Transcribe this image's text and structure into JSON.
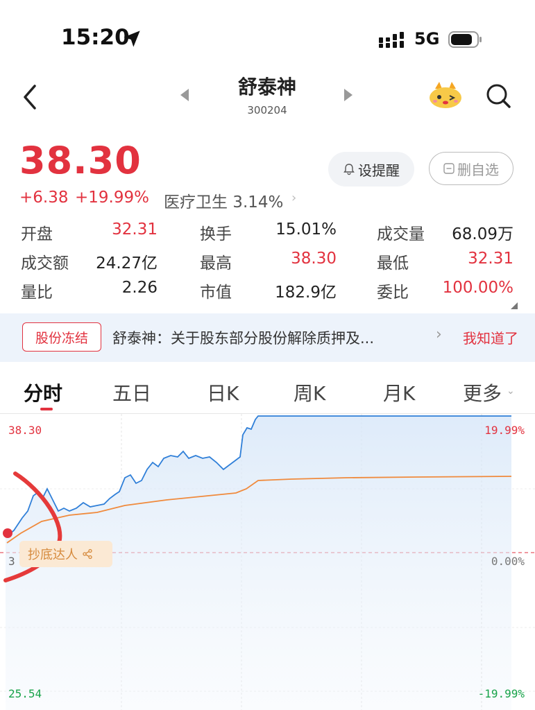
{
  "status_bar": {
    "time": "15:20",
    "network": "5G"
  },
  "header": {
    "stock_name": "舒泰神",
    "stock_code": "300204"
  },
  "quote": {
    "price": "38.30",
    "change": "+6.38",
    "change_pct": "+19.99%",
    "sector": "医疗卫生 3.14%",
    "alert_button": "设提醒",
    "remove_button": "删自选"
  },
  "stats": [
    [
      {
        "label": "开盘",
        "value": "32.31",
        "color": "red"
      },
      {
        "label": "换手",
        "value": "15.01%",
        "color": "dark"
      },
      {
        "label": "成交量",
        "value": "68.09万",
        "color": "dark"
      }
    ],
    [
      {
        "label": "成交额",
        "value": "24.27亿",
        "color": "dark"
      },
      {
        "label": "最高",
        "value": "38.30",
        "color": "red"
      },
      {
        "label": "最低",
        "value": "32.31",
        "color": "red"
      }
    ],
    [
      {
        "label": "量比",
        "value": "2.26",
        "color": "dark"
      },
      {
        "label": "市值",
        "value": "182.9亿",
        "color": "dark"
      },
      {
        "label": "委比",
        "value": "100.00%",
        "color": "red"
      }
    ]
  ],
  "notice": {
    "tag": "股份冻结",
    "text": "舒泰神：关于股东部分股份解除质押及...",
    "action": "我知道了"
  },
  "tabs": [
    "分时",
    "五日",
    "日K",
    "周K",
    "月K",
    "更多"
  ],
  "chart_labels": {
    "left_top": "38.30",
    "left_mid": "3",
    "left_bottom": "25.54",
    "right_top": "19.99%",
    "right_mid": "0.00%",
    "right_bottom": "-19.99%",
    "badge": "抄底达人"
  },
  "colors": {
    "up": "#e2323f",
    "down": "#18a34a",
    "price_line": "#2f7fd8",
    "avg_line": "#f08a3c",
    "accent_bg": "#edf3fb"
  }
}
